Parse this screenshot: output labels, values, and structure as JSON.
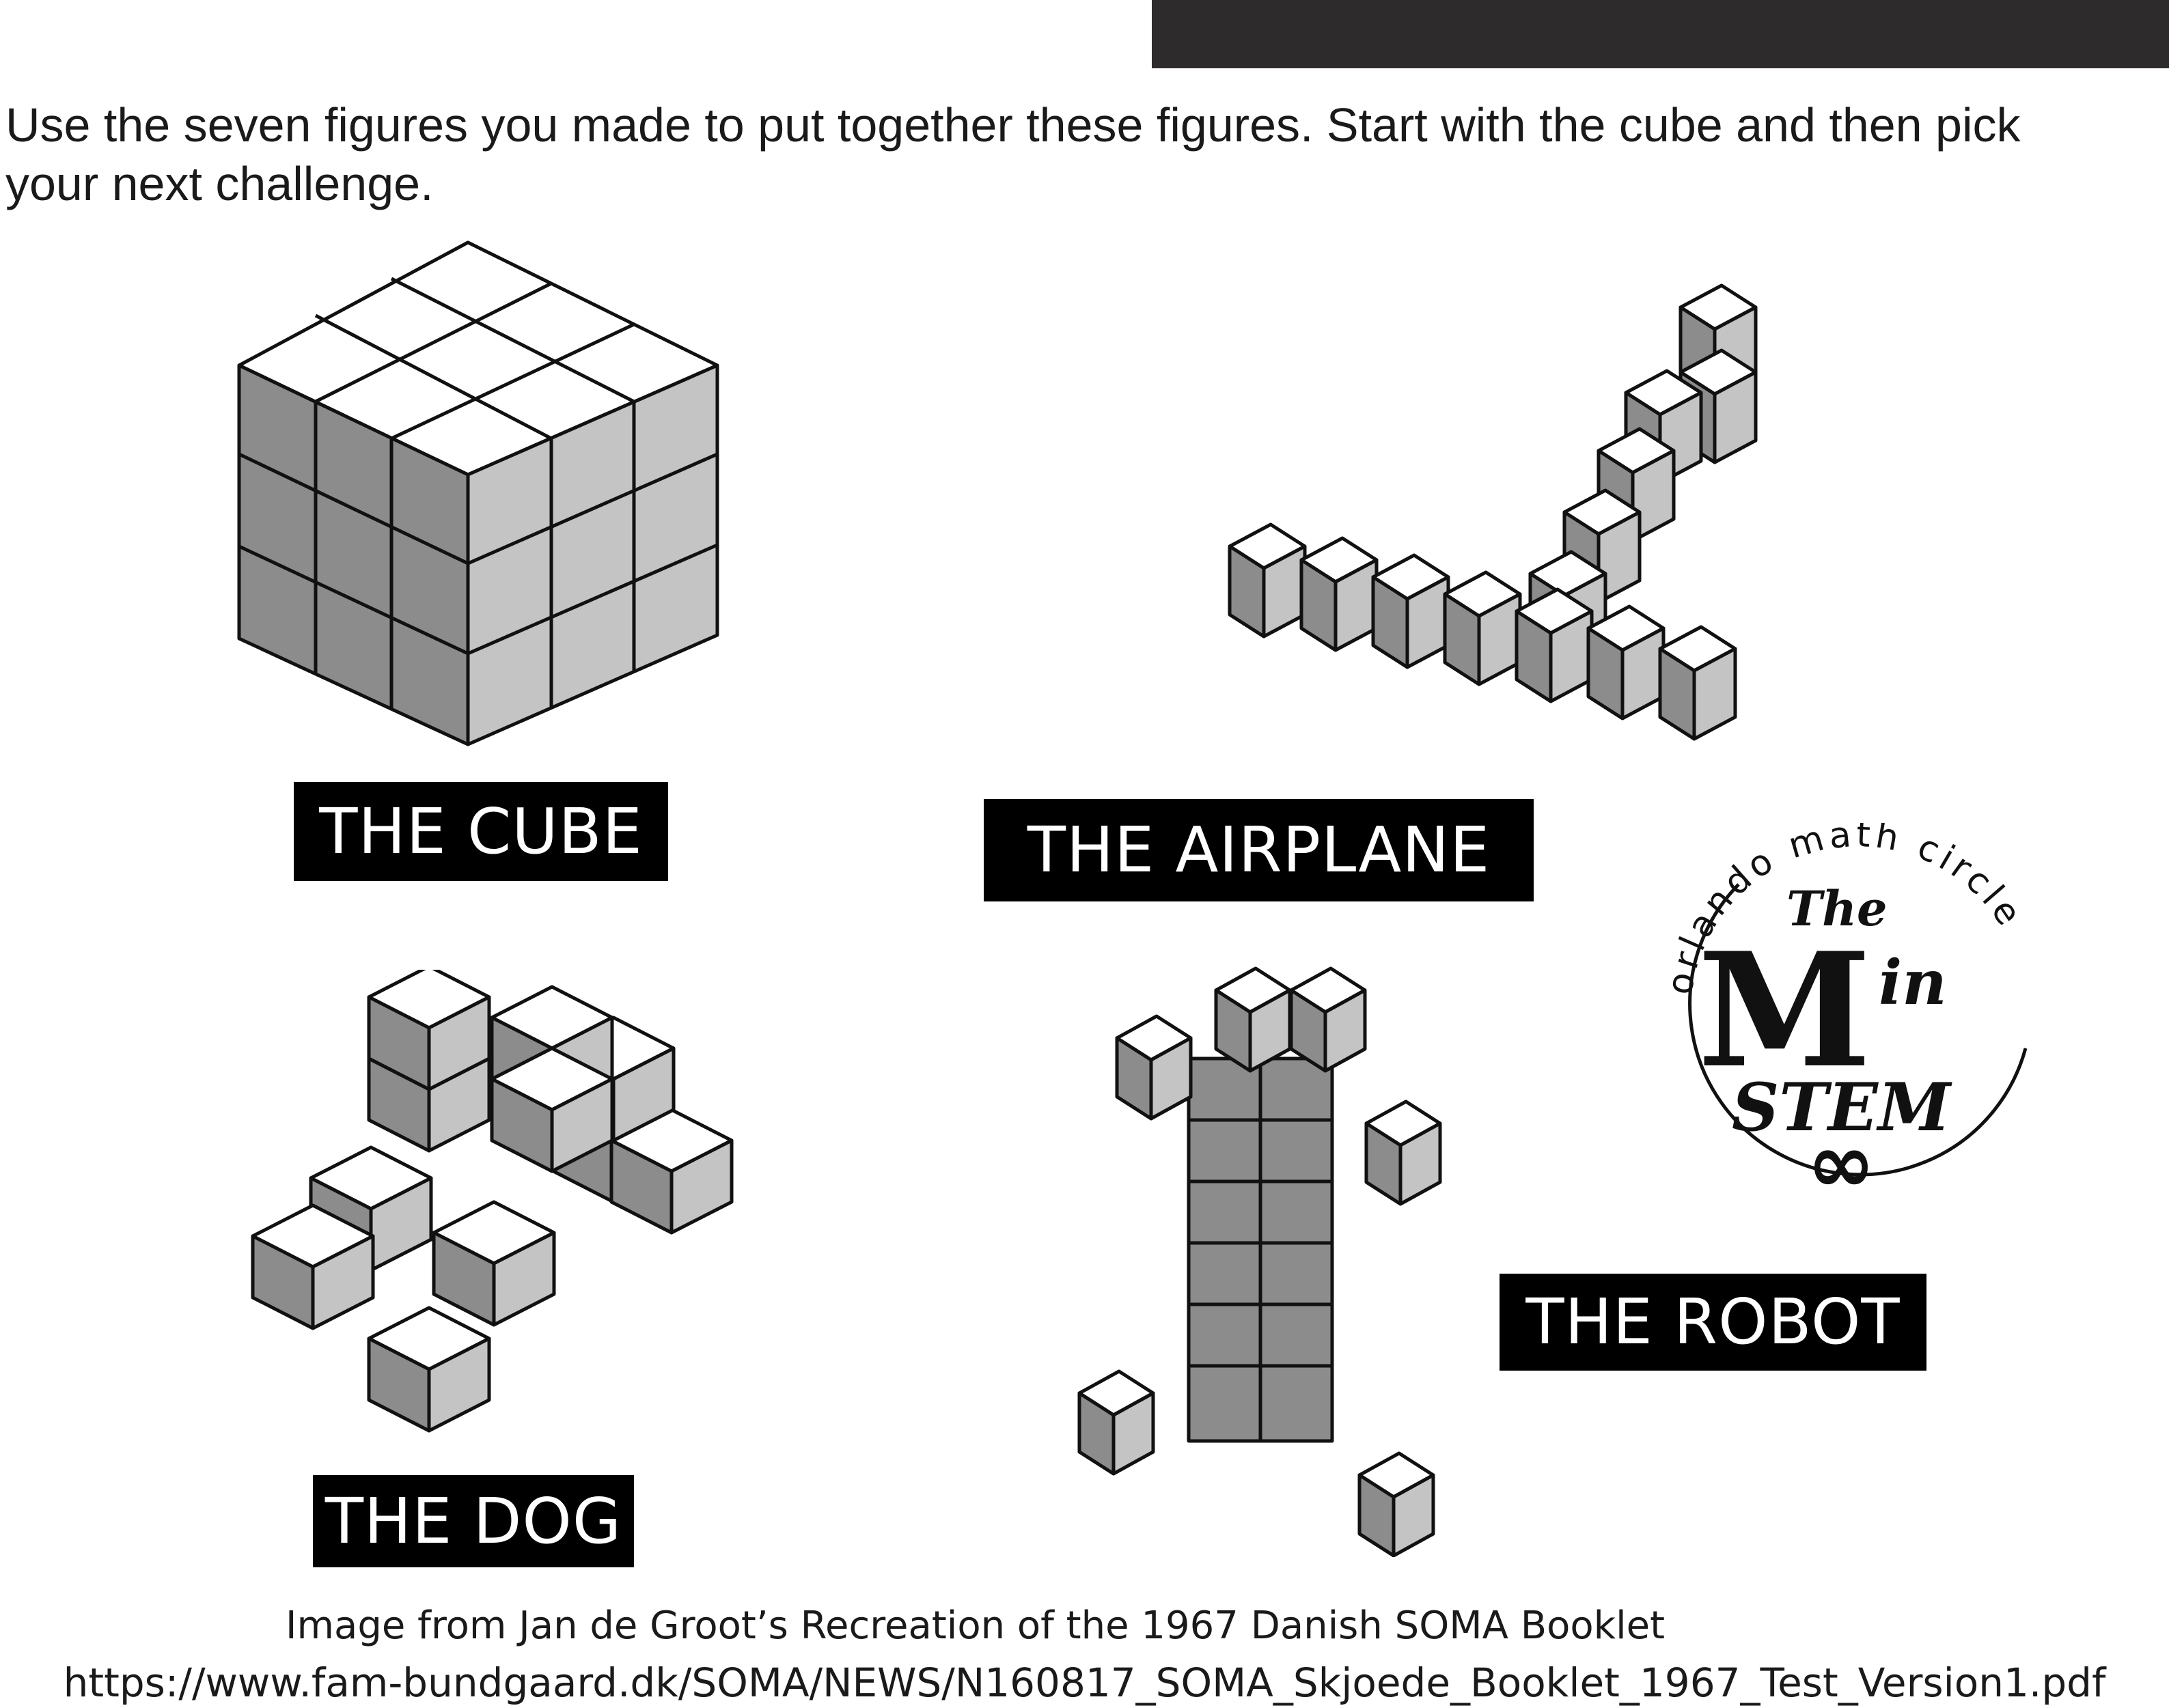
{
  "instructions": "Use the seven figures you made to put together these figures. Start with the cube and then pick your next challenge.",
  "labels": {
    "cube": "THE CUBE",
    "airplane": "THE AIRPLANE",
    "dog": "THE DOG",
    "robot": "THE ROBOT"
  },
  "logo": {
    "ring_text": "orlando math circle",
    "the": "The",
    "m": "M",
    "in": "in",
    "stem": "STEM",
    "infinity": "∞"
  },
  "credit": {
    "line1": "Image from Jan de Groot’s Recreation of the 1967 Danish SOMA Booklet",
    "line2": "https://www.fam-bundgaard.dk/SOMA/NEWS/N160817_SOMA_Skjoede_Booklet_1967_Test_Version1.pdf"
  },
  "colors": {
    "top_face": "#ffffff",
    "left_face": "#8c8c8c",
    "right_face": "#c4c4c4",
    "outline": "#111111",
    "label_bg": "#000000",
    "label_text": "#ffffff",
    "top_bar": "#2d2b2c"
  }
}
